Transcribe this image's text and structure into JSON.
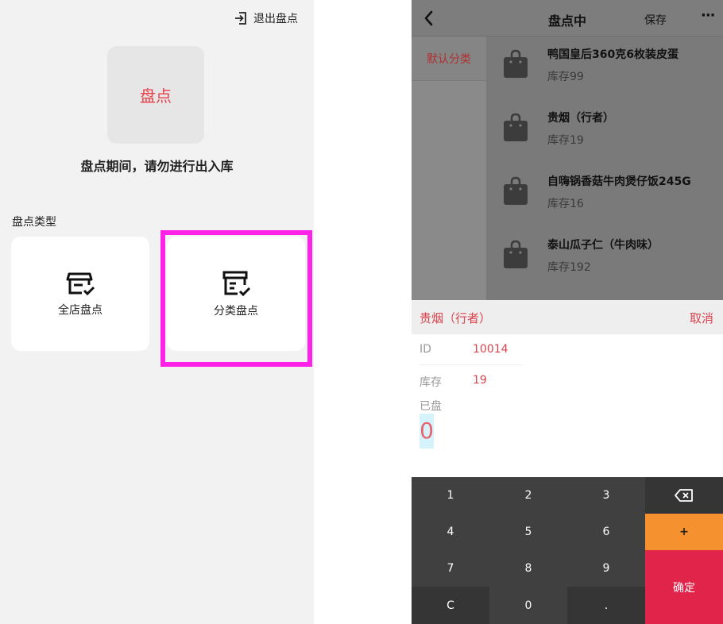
{
  "left": {
    "exit_label": "退出盘点",
    "tile_label": "盘点",
    "warning": "盘点期间，请勿进行出入库",
    "type_section_label": "盘点类型",
    "cards": [
      {
        "label": "全店盘点",
        "icon": "store-check-icon"
      },
      {
        "label": "分类盘点",
        "icon": "category-check-icon"
      }
    ]
  },
  "right": {
    "title": "盘点中",
    "save_label": "保存",
    "more_label": "···",
    "category": "默认分类",
    "products": [
      {
        "name": "鸭国皇后360克6枚装皮蛋",
        "stock": "库存99"
      },
      {
        "name": "贵烟（行者）",
        "stock": "库存19"
      },
      {
        "name": "自嗨锅香菇牛肉煲仔饭245G",
        "stock": "库存16"
      },
      {
        "name": "泰山瓜子仁（牛肉味）",
        "stock": "库存192"
      }
    ],
    "sheet": {
      "product_name": "贵烟（行者）",
      "cancel_label": "取消",
      "id_label": "ID",
      "id_value": "10014",
      "stock_label": "库存",
      "stock_value": "19",
      "counted_label": "已盘",
      "counted_value": "0"
    },
    "keypad": {
      "k1": "1",
      "k2": "2",
      "k3": "3",
      "k4": "4",
      "k5": "5",
      "k6": "6",
      "k7": "7",
      "k8": "8",
      "k9": "9",
      "kc": "C",
      "k0": "0",
      "kdot": ".",
      "plus": "+",
      "confirm": "确定"
    }
  },
  "colors": {
    "accent_red": "#d9434d",
    "highlight_magenta": "#ff22e8",
    "plus_orange": "#f5922f",
    "confirm_red": "#e0244a"
  }
}
